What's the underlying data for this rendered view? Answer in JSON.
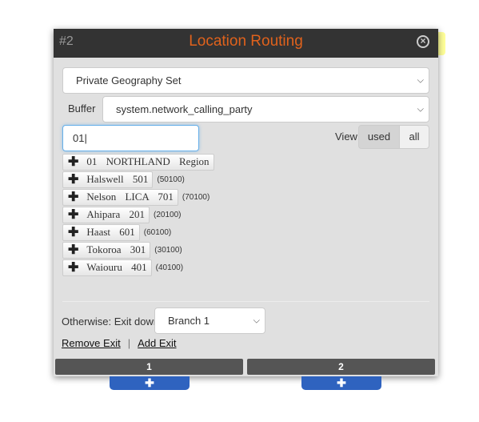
{
  "header": {
    "node_number": "#2",
    "title": "Location Routing",
    "close_icon": "circle-x-icon",
    "title_color": "#e0621c"
  },
  "geography_select": {
    "value": "Private Geography Set"
  },
  "buffer": {
    "label": "Buffer",
    "value": "system.network_calling_party"
  },
  "search": {
    "value": "01"
  },
  "view": {
    "label": "View",
    "options": [
      "used",
      "all"
    ],
    "selected": "used"
  },
  "locations": [
    {
      "label": "01 NORTHLAND Region",
      "code": ""
    },
    {
      "label": "Halswell 501",
      "code": "(50100)"
    },
    {
      "label": "Nelson LICA 701",
      "code": "(70100)"
    },
    {
      "label": "Ahipara 201",
      "code": "(20100)"
    },
    {
      "label": "Haast 601",
      "code": "(60100)"
    },
    {
      "label": "Tokoroa 301",
      "code": "(30100)"
    },
    {
      "label": "Waiouru 401",
      "code": "(40100)"
    }
  ],
  "otherwise": {
    "label": "Otherwise: Exit down",
    "value": "Branch 1"
  },
  "links": {
    "remove": "Remove Exit",
    "separator": "|",
    "add": "Add Exit"
  },
  "exits": [
    {
      "label": "1",
      "add": "✚"
    },
    {
      "label": "2",
      "add": "✚"
    }
  ]
}
